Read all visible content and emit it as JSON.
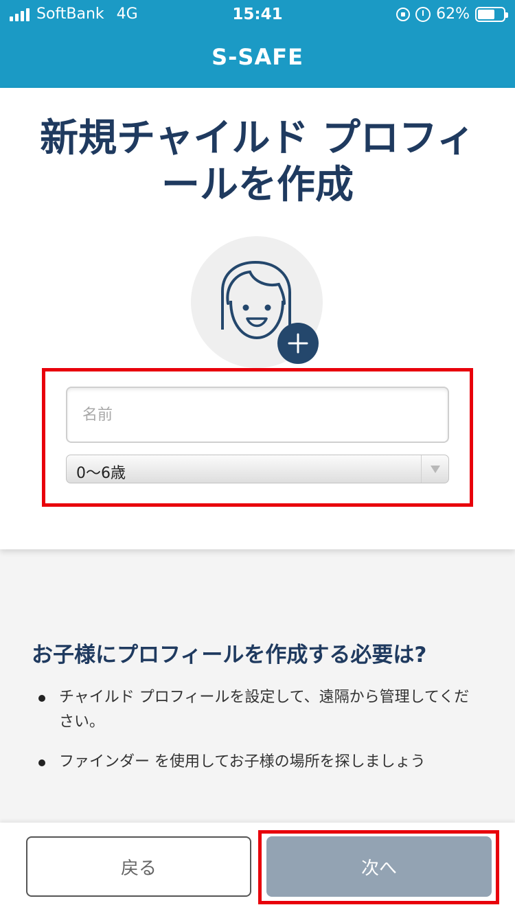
{
  "status_bar": {
    "carrier": "SoftBank",
    "network": "4G",
    "time": "15:41",
    "battery_percent": "62%"
  },
  "header": {
    "title": "S-SAFE"
  },
  "card": {
    "title": "新規チャイルド プロフィールを作成",
    "avatar_icon": "child-face-icon",
    "add_photo_icon": "plus-icon"
  },
  "form": {
    "name_placeholder": "名前",
    "name_value": "",
    "age_selected": "0〜6歳"
  },
  "info": {
    "title": "お子様にプロフィールを作成する必要は?",
    "bullets": [
      "チャイルド プロフィールを設定して、遠隔から管理してください。",
      "ファインダー を使用してお子様の場所を探しましょう"
    ]
  },
  "footer": {
    "back_label": "戻る",
    "next_label": "次へ"
  },
  "colors": {
    "header": "#1b9ac5",
    "title": "#1f3a5f",
    "highlight": "#e8000b",
    "next_button": "#93a3b3"
  }
}
